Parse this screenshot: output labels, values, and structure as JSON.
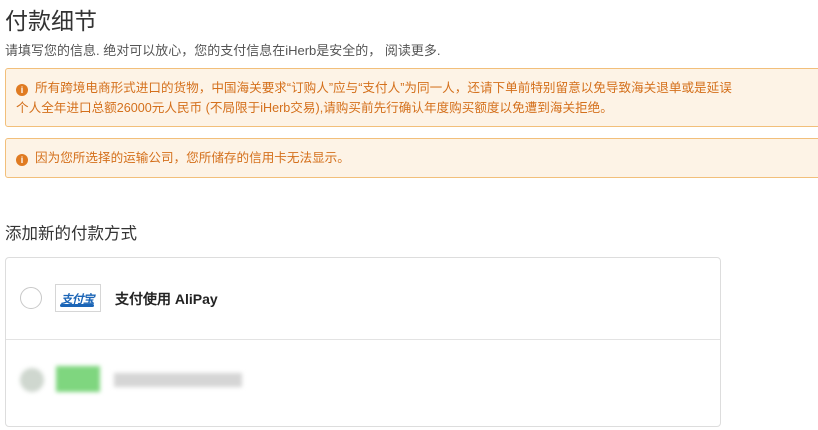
{
  "page": {
    "title": "付款细节",
    "subtitle": "请填写您的信息. 绝对可以放心，您的支付信息在iHerb是安全的， 阅读更多."
  },
  "notices": [
    {
      "icon": "info-icon",
      "line1": "所有跨境电商形式进口的货物，中国海关要求“订购人”应与“支付人”为同一人，还请下单前特别留意以免导致海关退单或是延误",
      "line2": "个人全年进口总额26000元人民币 (不局限于iHerb交易),请购买前先行确认年度购买额度以免遭到海关拒绝。"
    },
    {
      "icon": "info-icon",
      "line1": "因为您所选择的运输公司，您所储存的信用卡无法显示。"
    }
  ],
  "payment": {
    "section_title": "添加新的付款方式",
    "options": [
      {
        "logo_text": "支付宝",
        "label": "支付使用 AliPay",
        "selected": false
      }
    ]
  },
  "colors": {
    "notice_bg": "#fdf3e6",
    "notice_border": "#f2bf7a",
    "notice_text": "#d4701c",
    "alipay_blue": "#1a64b6"
  }
}
